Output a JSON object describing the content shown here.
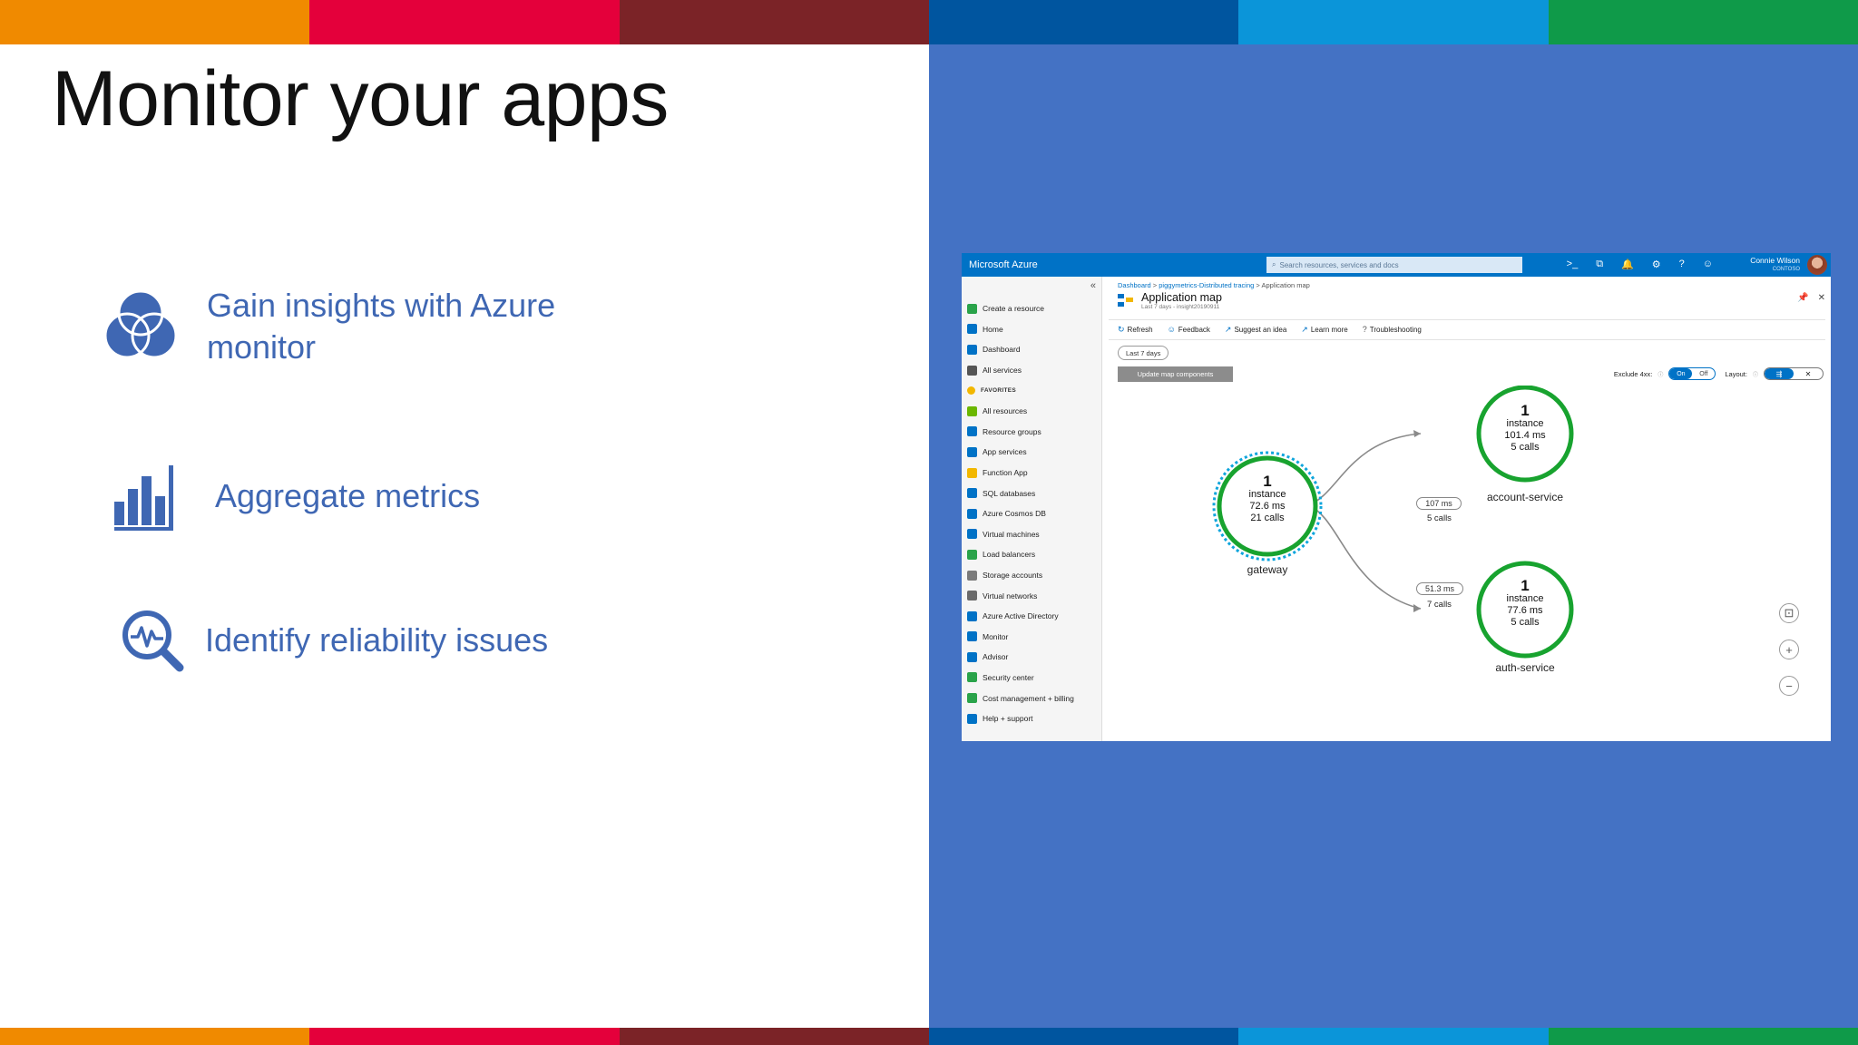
{
  "slide": {
    "title": "Monitor your apps",
    "colors": {
      "stripe": [
        "#f08a00",
        "#e4003b",
        "#7b2327",
        "#00559f",
        "#0b95d9",
        "#0f9a49"
      ],
      "panel": "#4472c4",
      "accent_text": "#3f67b3"
    },
    "bullets": [
      {
        "text_line1": "Gain insights with Azure",
        "text_line2": "monitor",
        "icon": "venn-diagram-icon"
      },
      {
        "text": "Aggregate metrics",
        "icon": "bar-chart-icon"
      },
      {
        "text": "Identify reliability issues",
        "icon": "magnifier-pulse-icon"
      }
    ]
  },
  "azure": {
    "brand": "Microsoft Azure",
    "search_placeholder": "Search resources, services and docs",
    "user_name": "Connie Wilson",
    "user_org": "CONTOSO",
    "sidebar": {
      "items": [
        {
          "label": "Create a resource",
          "color": "#2aa34a"
        },
        {
          "label": "Home",
          "color": "#0072c6"
        },
        {
          "label": "Dashboard",
          "color": "#0072c6"
        },
        {
          "label": "All services",
          "color": "#555555"
        },
        {
          "label": "FAVORITES",
          "color": "#f2b700"
        },
        {
          "label": "All resources",
          "color": "#6bb700"
        },
        {
          "label": "Resource groups",
          "color": "#0072c6"
        },
        {
          "label": "App services",
          "color": "#0072c6"
        },
        {
          "label": "Function App",
          "color": "#f2b700"
        },
        {
          "label": "SQL databases",
          "color": "#0072c6"
        },
        {
          "label": "Azure Cosmos DB",
          "color": "#0072c6"
        },
        {
          "label": "Virtual machines",
          "color": "#0072c6"
        },
        {
          "label": "Load balancers",
          "color": "#2aa34a"
        },
        {
          "label": "Storage accounts",
          "color": "#7a7a7a"
        },
        {
          "label": "Virtual networks",
          "color": "#6b6b6b"
        },
        {
          "label": "Azure Active Directory",
          "color": "#0072c6"
        },
        {
          "label": "Monitor",
          "color": "#0072c6"
        },
        {
          "label": "Advisor",
          "color": "#0072c6"
        },
        {
          "label": "Security center",
          "color": "#2aa34a"
        },
        {
          "label": "Cost management + billing",
          "color": "#2aa34a"
        },
        {
          "label": "Help + support",
          "color": "#0072c6"
        }
      ]
    },
    "breadcrumb": {
      "a": "Dashboard",
      "b": "piggymetrics-Distributed tracing",
      "c": "Application map"
    },
    "blade": {
      "title": "Application map",
      "subtitle": "Last 7 days - insight20190911"
    },
    "toolbar": {
      "refresh": "Refresh",
      "feedback": "Feedback",
      "suggest": "Suggest an idea",
      "learn": "Learn more",
      "troubleshoot": "Troubleshooting"
    },
    "time_range": "Last 7 days",
    "update_button": "Update map components",
    "exclude_label": "Exclude 4xx:",
    "on_label": "On",
    "off_label": "Off",
    "layout_label": "Layout:",
    "nodes": {
      "gateway": {
        "count": "1",
        "kind": "instance",
        "latency": "72.6 ms",
        "calls": "21 calls",
        "name": "gateway"
      },
      "account": {
        "count": "1",
        "kind": "instance",
        "latency": "101.4 ms",
        "calls": "5 calls",
        "name": "account-service"
      },
      "auth": {
        "count": "1",
        "kind": "instance",
        "latency": "77.6 ms",
        "calls": "5 calls",
        "name": "auth-service"
      }
    },
    "edges": {
      "to_account": {
        "latency": "107 ms",
        "calls": "5 calls"
      },
      "to_auth": {
        "latency": "51.3 ms",
        "calls": "7 calls"
      }
    }
  }
}
